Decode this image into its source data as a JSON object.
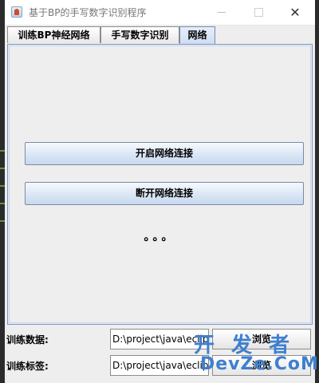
{
  "window": {
    "title": "基于BP的手写数字识别程序",
    "minimize_icon": "minimize-icon",
    "maximize_icon": "maximize-icon",
    "close_glyph": "✕"
  },
  "tabs": [
    {
      "label": "训练BP神经网络",
      "selected": false
    },
    {
      "label": "手写数字识别",
      "selected": false
    },
    {
      "label": "网络",
      "selected": true
    }
  ],
  "network_panel": {
    "connect_label": "开启网络连接",
    "disconnect_label": "断开网络连接",
    "status_text": "。。。"
  },
  "form": {
    "training_data_label": "训练数据:",
    "training_data_value": "D:\\project\\java\\eclipse",
    "training_data_button": "浏览",
    "training_label_label": "训练标签:",
    "training_label_value": "D:\\project\\java\\eclipse",
    "training_label_button": "浏览"
  },
  "watermark": {
    "top": "开 发 者",
    "bottom": "DevZe.CoM"
  },
  "colors": {
    "accent": "#7a96c4",
    "watermark": "#3f7fd0"
  }
}
